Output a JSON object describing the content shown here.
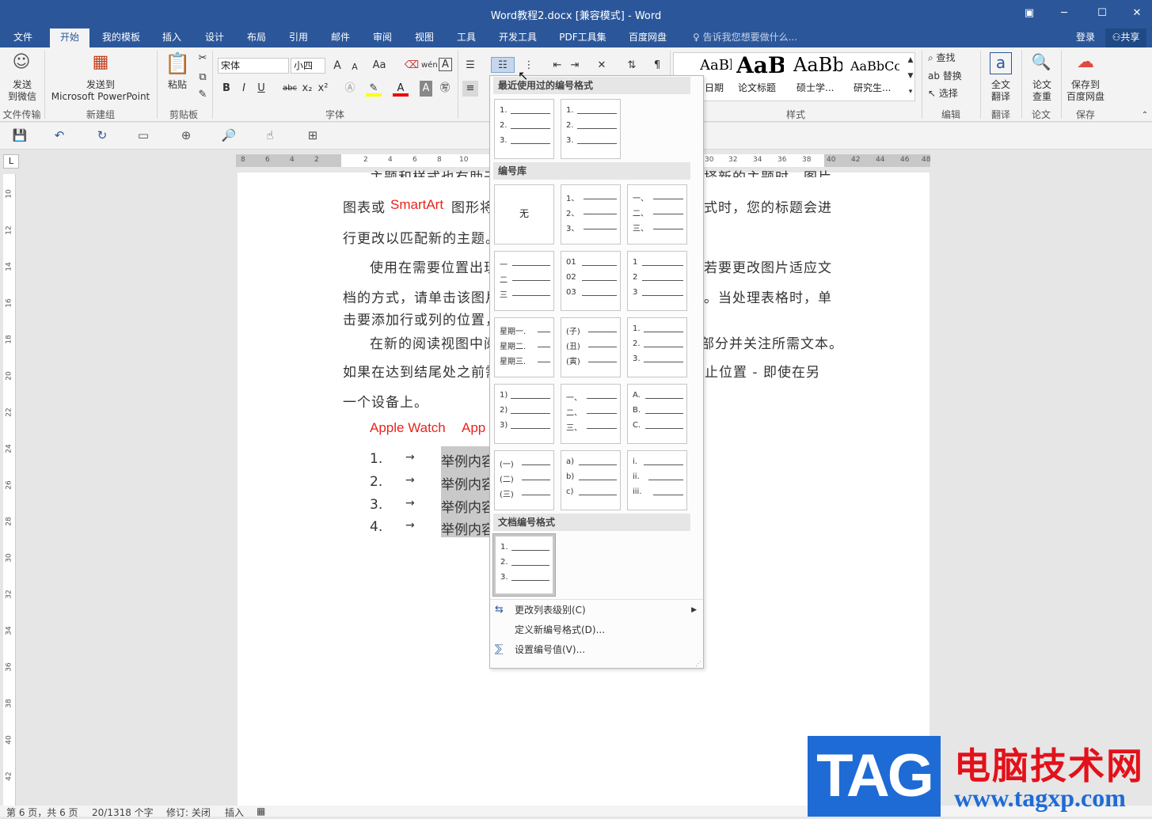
{
  "window": {
    "title": "Word教程2.docx [兼容模式] - Word",
    "btn_ribbon": "▣",
    "btn_min": "─",
    "btn_max": "☐",
    "btn_close": "✕"
  },
  "tabs": [
    "文件",
    "开始",
    "我的模板",
    "插入",
    "设计",
    "布局",
    "引用",
    "邮件",
    "审阅",
    "视图",
    "工具",
    "开发工具",
    "PDF工具集",
    "百度网盘"
  ],
  "tellme": "告诉我您想要做什么...",
  "login": "登录",
  "share": "共享",
  "ribbon": {
    "wechat": {
      "line1": "发送",
      "line2": "到微信",
      "group": "文件传输"
    },
    "ppt": {
      "line1": "发送到",
      "line2": "Microsoft PowerPoint",
      "group": "新建组"
    },
    "paste": {
      "label": "粘贴",
      "group": "剪贴板"
    },
    "font": {
      "name": "宋体",
      "size": "小四",
      "group": "字体",
      "bold": "B",
      "italic": "I",
      "underline": "U",
      "strike": "abc",
      "sub": "x₂",
      "sup": "x²",
      "grow": "A",
      "shrink": "A",
      "case": "Aa",
      "phonetic": "wén",
      "border_a": "A"
    },
    "styles": {
      "group": "样式",
      "items": [
        {
          "preview": "AaBbCc",
          "name": "日期"
        },
        {
          "preview": "AaB",
          "name": "论文标题"
        },
        {
          "preview": "AaBb",
          "name": "硕士学..."
        },
        {
          "preview": "AaBbCc",
          "name": "研究生..."
        }
      ]
    },
    "edit": {
      "find": "查找",
      "replace": "替换",
      "select": "选择",
      "group": "编辑"
    },
    "translate": {
      "line1": "全文",
      "line2": "翻译",
      "group": "翻译"
    },
    "paper": {
      "line1": "论文",
      "line2": "查重",
      "group": "论文"
    },
    "save": {
      "line1": "保存到",
      "line2": "百度网盘",
      "group": "保存"
    }
  },
  "ruler_h": [
    "8",
    "6",
    "4",
    "2",
    "2",
    "4",
    "6",
    "8",
    "10",
    "30",
    "32",
    "34",
    "36",
    "38",
    "40",
    "42",
    "44",
    "46",
    "48"
  ],
  "ruler_v": [
    "10",
    "12",
    "14",
    "16",
    "18",
    "20",
    "22",
    "24",
    "26",
    "28",
    "30",
    "32",
    "34",
    "36",
    "38",
    "40",
    "42"
  ],
  "document": {
    "line0a": "主题和样式也有助于",
    "line0b": "择新的主题时，图片、",
    "line1a": "图表或",
    "smartart": "SmartArt",
    "line1b": "图形将",
    "line1c": "式时，您的标题会进",
    "line2": "行更改以匹配新的主题。",
    "line3a": "使用在需要位置出现",
    "line3b": "若要更改图片适应文",
    "line4a": "档的方式，请单击该图片",
    "line4b": "。当处理表格时，单",
    "line5": "击要添加行或列的位置，",
    "line6a": "在新的阅读视图中阅",
    "line6b": "部分并关注所需文本。",
    "line7a": "如果在达到结尾处之前需",
    "line7b": "止位置 - 即使在另",
    "line8": "一个设备上。",
    "apple1": "Apple Watch",
    "apple2": "App",
    "list": [
      {
        "num": "1.",
        "arrow": "→",
        "text": "举例内容"
      },
      {
        "num": "2.",
        "arrow": "→",
        "text": "举例内容"
      },
      {
        "num": "3.",
        "arrow": "→",
        "text": "举例内容"
      },
      {
        "num": "4.",
        "arrow": "→",
        "text": "举例内容"
      }
    ]
  },
  "menu": {
    "recent_header": "最近使用过的编号格式",
    "library_header": "编号库",
    "doc_header": "文档编号格式",
    "none": "无",
    "change_level": "更改列表级别(C)",
    "define_new": "定义新编号格式(D)...",
    "set_value": "设置编号值(V)..."
  },
  "status": {
    "page": "第 6 页，共 6 页",
    "words": "20/1318 个字",
    "track": "修订: 关闭",
    "insert": "插入"
  },
  "watermark": {
    "tag": "TAG",
    "cn": "电脑技术网",
    "url": "www.tagxp.com"
  },
  "colors": {
    "brand": "#2b579a",
    "red_text": "#e8231e",
    "tag_blue": "#1e6bd6"
  }
}
